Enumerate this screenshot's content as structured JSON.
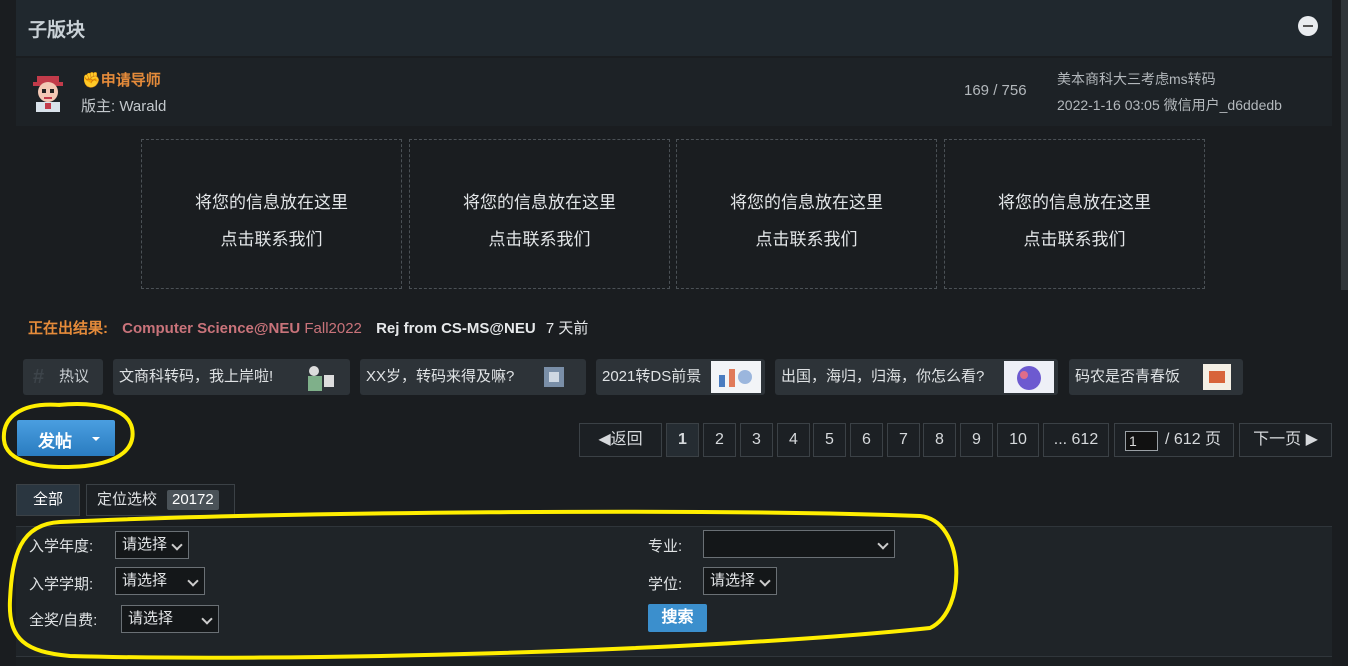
{
  "header": {
    "title": "子版块"
  },
  "forum": {
    "name": "申请导师",
    "moderator": "版主: Warald",
    "stats": "169 / 756",
    "last_post_title": "美本商科大三考虑ms转码",
    "last_post_meta": "2022-1-16 03:05 微信用户_d6ddedb"
  },
  "ads": [
    {
      "line1": "将您的信息放在这里",
      "line2": "点击联系我们"
    },
    {
      "line1": "将您的信息放在这里",
      "line2": "点击联系我们"
    },
    {
      "line1": "将您的信息放在这里",
      "line2": "点击联系我们"
    },
    {
      "line1": "将您的信息放在这里",
      "line2": "点击联系我们"
    }
  ],
  "results": {
    "label": "正在出结果:",
    "school": "Computer Science@NEU",
    "term": "Fall2022",
    "outcome": "Rej from CS-MS@NEU",
    "ago": "7 天前"
  },
  "hot": {
    "hashtag_symbol": "#",
    "label": "热议",
    "items": [
      "文商科转码，我上岸啦!",
      "XX岁，转码来得及嘛?",
      "2021转DS前景",
      "出国，海归，归海，你怎么看?",
      "码农是否青春饭"
    ]
  },
  "toolbar": {
    "new_post_label": "发帖"
  },
  "pagination": {
    "back": "返回",
    "pages": [
      "1",
      "2",
      "3",
      "4",
      "5",
      "6",
      "7",
      "8",
      "9",
      "10"
    ],
    "current": "1",
    "last": "... 612",
    "input_value": "1",
    "total": "/ 612 页",
    "next": "下一页"
  },
  "tabs": {
    "all": "全部",
    "position_label": "定位选校",
    "position_count": "20172"
  },
  "filters": {
    "year_label": "入学年度:",
    "year_value": "请选择",
    "semester_label": "入学学期:",
    "semester_value": "请选择",
    "funding_label": "全奖/自费:",
    "funding_value": "请选择",
    "major_label": "专业:",
    "major_value": "",
    "degree_label": "学位:",
    "degree_value": "请选择",
    "search_label": "搜索"
  },
  "colors": {
    "accent_orange": "#e58b3a",
    "accent_blue": "#3b8fcd",
    "result_red": "#c9737a",
    "highlight_yellow": "#ffee00"
  }
}
